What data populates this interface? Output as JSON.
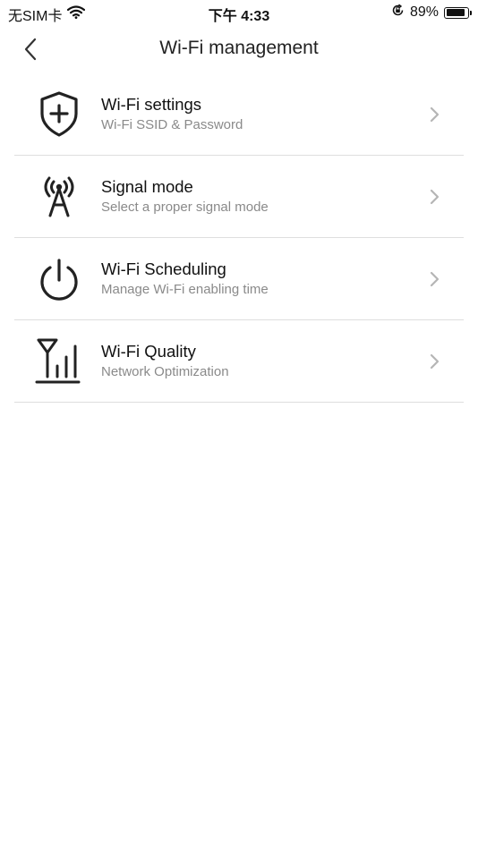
{
  "status_bar": {
    "carrier": "无SIM卡",
    "time": "下午 4:33",
    "battery_percent": "89%",
    "battery_level": 0.89,
    "icons": [
      "wifi-icon",
      "orientation-lock-icon",
      "battery-icon"
    ]
  },
  "nav": {
    "title": "Wi-Fi management",
    "back_icon": "chevron-left-icon"
  },
  "menu": {
    "items": [
      {
        "title": "Wi-Fi settings",
        "subtitle": "Wi-Fi SSID & Password",
        "icon": "shield-plus-icon"
      },
      {
        "title": "Signal mode",
        "subtitle": "Select a proper signal mode",
        "icon": "antenna-tower-icon"
      },
      {
        "title": "Wi-Fi Scheduling",
        "subtitle": "Manage Wi-Fi enabling time",
        "icon": "power-icon"
      },
      {
        "title": "Wi-Fi Quality",
        "subtitle": "Network Optimization",
        "icon": "signal-bars-icon"
      }
    ]
  },
  "colors": {
    "background": "#ffffff",
    "divider": "#dedede",
    "subtitle": "#8a8a8a",
    "chevron": "#b5b5b5"
  }
}
